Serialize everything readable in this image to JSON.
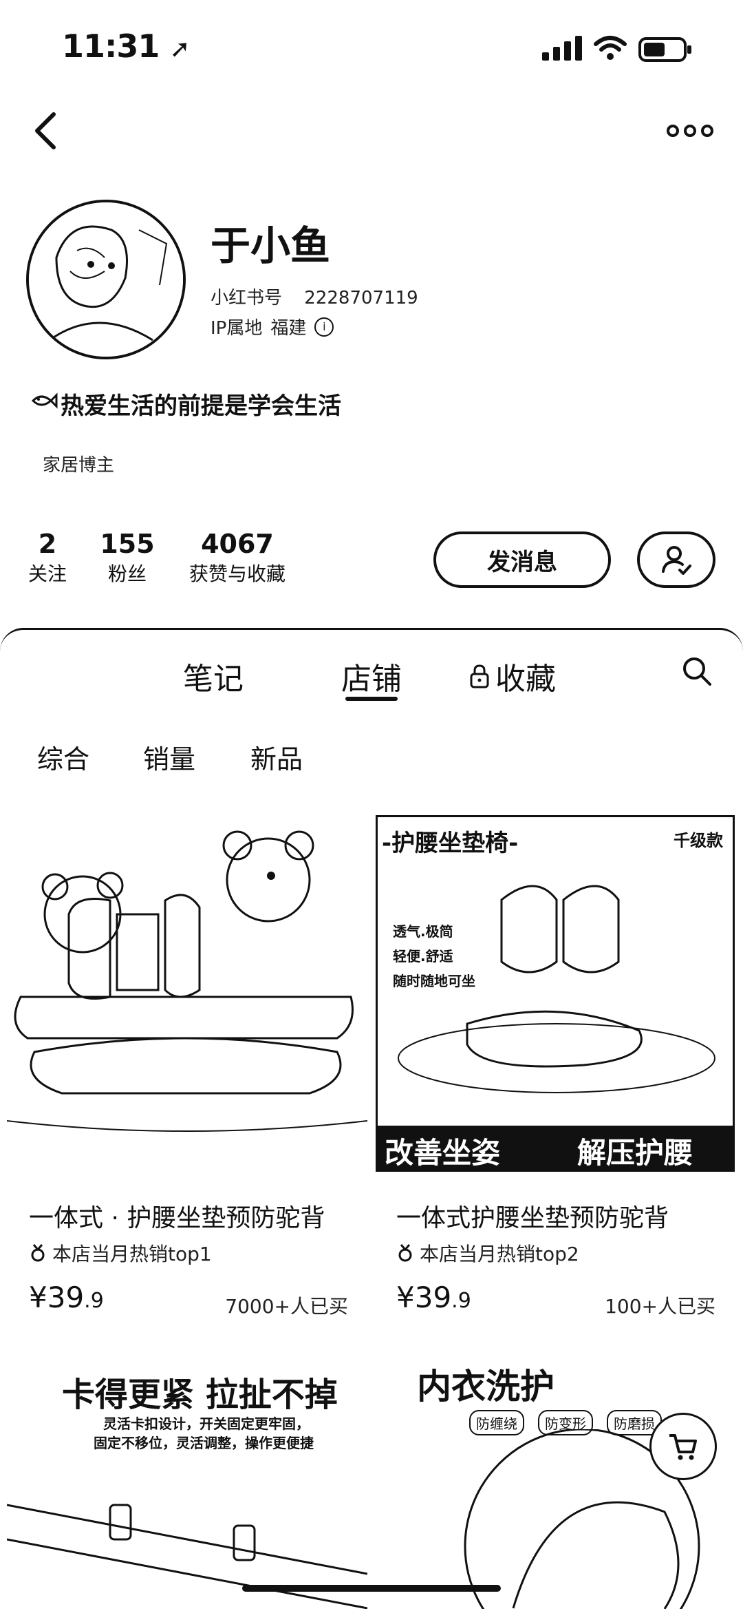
{
  "status_bar": {
    "time": "11:31"
  },
  "profile": {
    "name": "于小鱼",
    "id_label": "小红书号",
    "id_value": "2228707119",
    "ip_label": "IP属地",
    "ip_value": "福建",
    "bio": "热爱生活的前提是学会生活",
    "tag": "家居博主",
    "stats": [
      {
        "value": "2",
        "label": "关注"
      },
      {
        "value": "155",
        "label": "粉丝"
      },
      {
        "value": "4067",
        "label": "获赞与收藏"
      }
    ],
    "message_button": "发消息"
  },
  "tabs": [
    {
      "label": "笔记",
      "active": false
    },
    {
      "label": "店铺",
      "active": true
    },
    {
      "label": "收藏",
      "active": false,
      "locked": true
    }
  ],
  "filters": [
    "综合",
    "销量",
    "新品"
  ],
  "products": [
    {
      "title": "一体式 · 护腰坐垫预防驼背",
      "rank": "本店当月热销top1",
      "price_main": "¥39",
      "price_dec": ".9",
      "sold": "7000+人已买"
    },
    {
      "title": "一体式护腰坐垫预防驼背",
      "rank": "本店当月热销top2",
      "price_main": "¥39",
      "price_dec": ".9",
      "sold": "100+人已买",
      "image_text": {
        "banner": "-护腰坐垫椅-",
        "corner": "千级款",
        "features": [
          "透气.极简",
          "轻便.舒适",
          "随时随地可坐"
        ],
        "bottom_left": "改善坐姿",
        "bottom_right": "解压护腰"
      }
    },
    {
      "image_text": {
        "headline": "卡得更紧 拉扯不掉",
        "sub1": "灵活卡扣设计，开关固定更牢固，",
        "sub2": "固定不移位，灵活调整，操作更便捷"
      }
    },
    {
      "image_text": {
        "headline": "内衣洗护",
        "badges": [
          "防缠绕",
          "防变形",
          "防磨损"
        ]
      }
    }
  ]
}
